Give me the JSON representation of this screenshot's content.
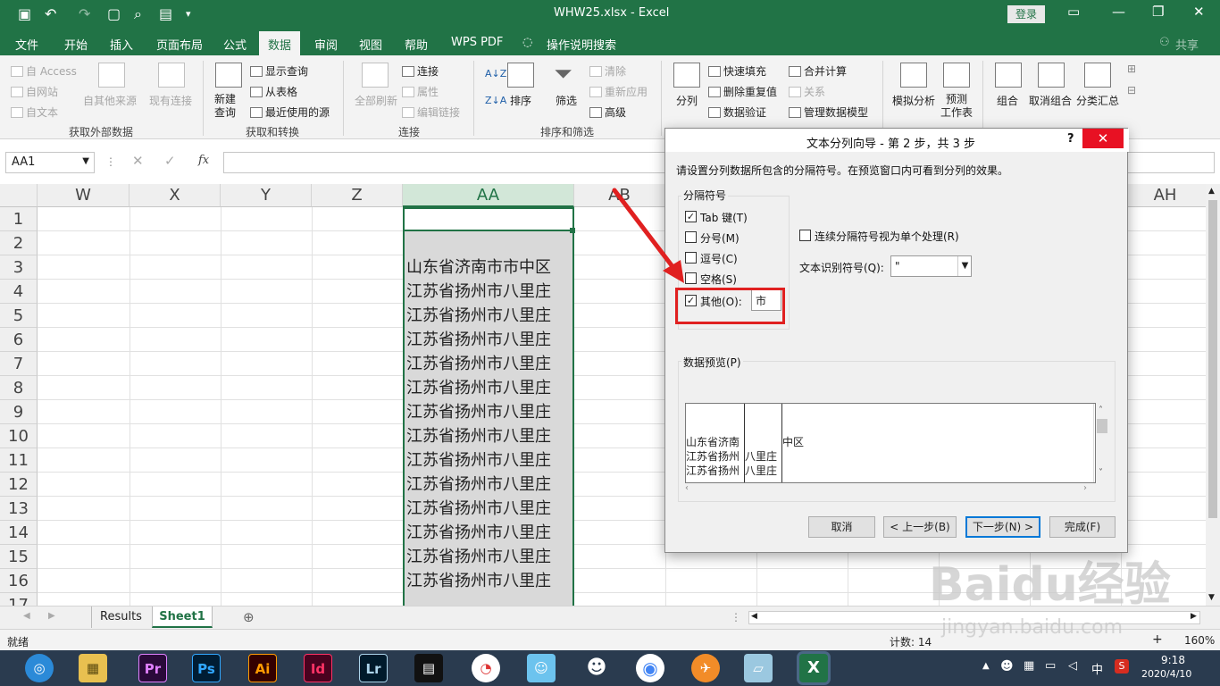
{
  "titlebar": {
    "title": "WHW25.xlsx  -  Excel",
    "login": "登录",
    "minimize": "—",
    "restore": "❐",
    "close": "✕",
    "bg": "#217346"
  },
  "menu": {
    "tabs": [
      "文件",
      "开始",
      "插入",
      "页面布局",
      "公式",
      "数据",
      "审阅",
      "视图",
      "帮助",
      "WPS PDF",
      "操作说明搜索"
    ],
    "active": "数据",
    "share": "共享"
  },
  "ribbon": {
    "get_external": {
      "items": [
        "自 Access",
        "自网站",
        "自文本",
        "自其他来源",
        "现有连接"
      ],
      "group": "获取外部数据"
    },
    "get_transform": {
      "new_query": "新建\n查询",
      "items": [
        "显示查询",
        "从表格",
        "最近使用的源"
      ],
      "group": "获取和转换"
    },
    "connections": {
      "refresh_all": "全部刷新",
      "items": [
        "连接",
        "属性",
        "编辑链接"
      ],
      "group": "连接"
    },
    "sort_filter": {
      "sort": "排序",
      "filter": "筛选",
      "items": [
        "清除",
        "重新应用",
        "高级"
      ],
      "group": "排序和筛选"
    },
    "data_tools": {
      "split": "分列",
      "items": [
        "快速填充",
        "删除重复值",
        "数据验证",
        "合并计算",
        "关系",
        "管理数据模型"
      ]
    },
    "forecast": {
      "whatif": "模拟分析",
      "forecast_sheet": "预测\n工作表"
    },
    "outline": {
      "group_btn": "组合",
      "ungroup": "取消组合",
      "subtotal": "分类汇总"
    }
  },
  "formula_bar": {
    "name_box": "AA1",
    "fx": "fx",
    "formula": ""
  },
  "grid": {
    "columns": [
      "W",
      "X",
      "Y",
      "Z",
      "AA",
      "AB",
      "",
      "",
      "",
      "",
      "",
      "AH"
    ],
    "selected_column": "AA",
    "rows": [
      "1",
      "2",
      "3",
      "4",
      "5",
      "6",
      "7",
      "8",
      "9",
      "10",
      "11",
      "12",
      "13",
      "14",
      "15",
      "16",
      "17"
    ],
    "aa_values": [
      "",
      "",
      "山东省济南市市中区",
      "江苏省扬州市八里庄",
      "江苏省扬州市八里庄",
      "江苏省扬州市八里庄",
      "江苏省扬州市八里庄",
      "江苏省扬州市八里庄",
      "江苏省扬州市八里庄",
      "江苏省扬州市八里庄",
      "江苏省扬州市八里庄",
      "江苏省扬州市八里庄",
      "江苏省扬州市八里庄",
      "江苏省扬州市八里庄",
      "江苏省扬州市八里庄",
      "江苏省扬州市八里庄"
    ]
  },
  "sheets": {
    "tabs": [
      "Results",
      "Sheet1"
    ],
    "active": "Sheet1"
  },
  "status": {
    "ready": "就绪",
    "count": "计数: 14",
    "zoom": "160%"
  },
  "taskbar": {
    "apps": [
      "Pr",
      "Ps",
      "Ai",
      "Id",
      "Lr"
    ],
    "time": "9:18",
    "date": "2020/4/10",
    "ime": "中",
    "s_icon": "S"
  },
  "dialog": {
    "title": "文本分列向导 - 第 2 步，共 3 步",
    "help": "?",
    "close": "✕",
    "instruction": "请设置分列数据所包含的分隔符号。在预览窗口内可看到分列的效果。",
    "delimiters_label": "分隔符号",
    "delimiters": [
      {
        "label": "Tab 键(T)",
        "checked": true
      },
      {
        "label": "分号(M)",
        "checked": false
      },
      {
        "label": "逗号(C)",
        "checked": false
      },
      {
        "label": "空格(S)",
        "checked": false
      },
      {
        "label": "其他(O):",
        "checked": true
      }
    ],
    "other_value": "市",
    "consecutive": "连续分隔符号视为单个处理(R)",
    "text_qualifier_label": "文本识别符号(Q):",
    "text_qualifier_value": "\"",
    "preview_label": "数据预览(P)",
    "preview_cols": [
      [
        "山东省济南",
        "江苏省扬州",
        "江苏省扬州"
      ],
      [
        "",
        "八里庄",
        "八里庄"
      ],
      [
        "中区",
        "",
        ""
      ]
    ],
    "buttons": {
      "cancel": "取消",
      "back": "< 上一步(B)",
      "next": "下一步(N) >",
      "finish": "完成(F)"
    }
  },
  "watermark": {
    "brand": "Baidu经验",
    "url": "jingyan.baidu.com"
  }
}
